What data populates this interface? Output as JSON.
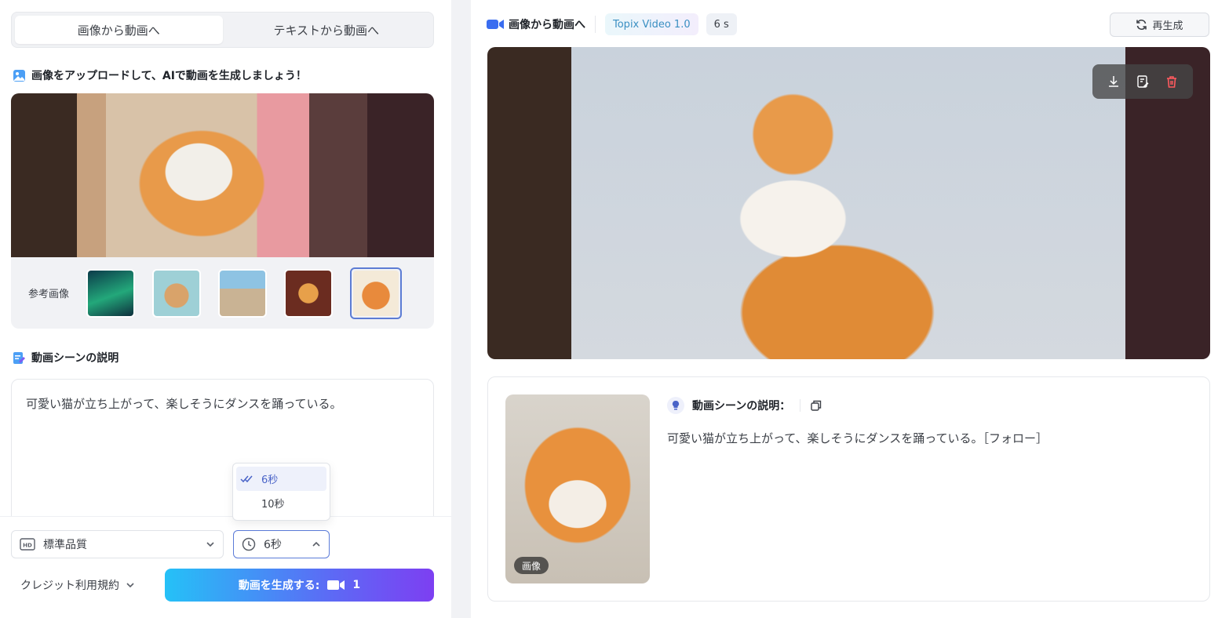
{
  "left": {
    "tabs": [
      {
        "label": "画像から動画へ",
        "active": true
      },
      {
        "label": "テキストから動画へ",
        "active": false
      }
    ],
    "upload_title": "画像をアップロードして、AIで動画を生成しましょう！",
    "ref_label": "参考画像",
    "ref_thumbs": [
      "aurora",
      "teddy-bear",
      "motocross",
      "perfume-bottle",
      "kitten"
    ],
    "selected_thumb": "kitten",
    "desc_title": "動画シーンの説明",
    "desc_text": "可愛い猫が立ち上がって、楽しそうにダンスを踊っている。",
    "quality": "標準品質",
    "duration": "6秒",
    "duration_options": [
      {
        "label": "6秒",
        "selected": true
      },
      {
        "label": "10秒",
        "selected": false
      }
    ],
    "credit_label": "クレジット利用規約",
    "generate_label": "動画を生成する:",
    "generate_cost": "1"
  },
  "right": {
    "title": "画像から動画へ",
    "model_badge": "Topix Video 1.0",
    "duration_badge": "6 s",
    "regen_label": "再生成",
    "info_title": "動画シーンの説明：",
    "info_text": "可愛い猫が立ち上がって、楽しそうにダンスを踊っている。［フォロー］",
    "thumb_tag": "画像"
  },
  "colors": {
    "accent": "#5b6cf5",
    "gradient_start": "#25c1f7",
    "gradient_end": "#7d3ff2",
    "delete_red": "#ff5a5f",
    "selected_blue": "#4a64c8"
  }
}
